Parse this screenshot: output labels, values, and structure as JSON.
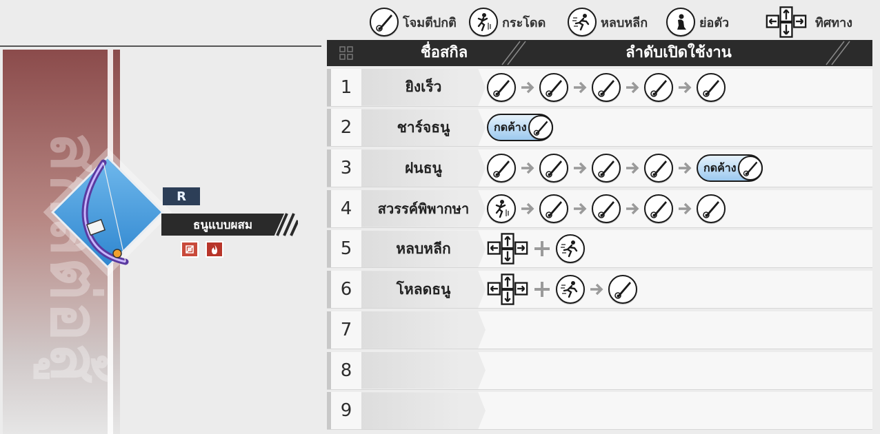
{
  "legend": [
    {
      "icon": "normal-attack-icon",
      "label": "โจมตีปกติ"
    },
    {
      "icon": "jump-icon",
      "label": "กระโดด"
    },
    {
      "icon": "dodge-icon",
      "label": "หลบหลีก"
    },
    {
      "icon": "crouch-icon",
      "label": "ย่อตัว"
    },
    {
      "icon": "direction-keys-icon",
      "label": "ทิศทาง"
    }
  ],
  "character": {
    "banner_text": "สกิลต่อสู้",
    "rank": "R",
    "weapon_name": "ธนูแบบผสม",
    "attributes": [
      "physical-attribute-icon",
      "fire-attribute-icon"
    ]
  },
  "table": {
    "header_name": "ชื่อสกิล",
    "header_order": "ลำดับเปิดใช้งาน",
    "hold_label": "กดค้าง",
    "rows": [
      {
        "num": "1",
        "name": "ยิงเร็ว"
      },
      {
        "num": "2",
        "name": "ชาร์จธนู"
      },
      {
        "num": "3",
        "name": "ฝนธนู"
      },
      {
        "num": "4",
        "name": "สวรรค์พิพากษา"
      },
      {
        "num": "5",
        "name": "หลบหลีก"
      },
      {
        "num": "6",
        "name": "โหลดธนู"
      },
      {
        "num": "7",
        "name": ""
      },
      {
        "num": "8",
        "name": ""
      },
      {
        "num": "9",
        "name": ""
      }
    ]
  },
  "colors": {
    "header_bg": "#2b2b2b",
    "banner_top": "#8b4b4b",
    "diamond": "#3d8fd4",
    "rank_bg": "#2c3e57",
    "hold_button": "#9cc9ef"
  }
}
